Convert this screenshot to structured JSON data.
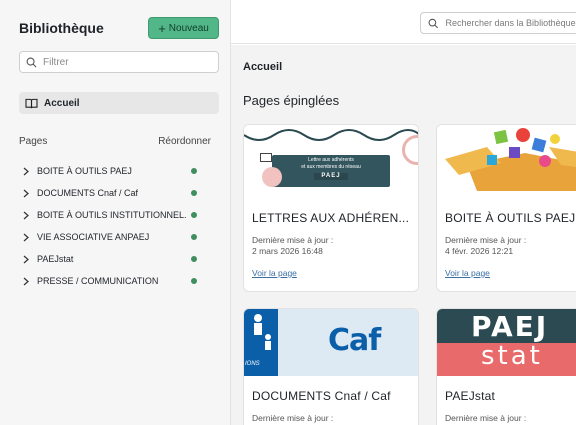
{
  "sidebar": {
    "title": "Bibliothèque",
    "new_button": {
      "icon": "plus-icon",
      "label": "Nouveau"
    },
    "filter": {
      "placeholder": "Filtrer"
    },
    "home": {
      "icon": "book-icon",
      "label": "Accueil"
    },
    "pages_label": "Pages",
    "reorder_label": "Réordonner",
    "pages": [
      {
        "label": "BOITE À OUTILS PAEJ"
      },
      {
        "label": "DOCUMENTS Cnaf / Caf"
      },
      {
        "label": "BOITE À OUTILS INSTITUTIONNEL..."
      },
      {
        "label": "VIE ASSOCIATIVE ANPAEJ"
      },
      {
        "label": "PAEJstat"
      },
      {
        "label": "PRESSE / COMMUNICATION"
      }
    ]
  },
  "topbar": {
    "search": {
      "placeholder": "Rechercher dans la Bibliothèque"
    }
  },
  "main": {
    "breadcrumb": "Accueil",
    "pinned_title": "Pages épinglées",
    "cards": [
      {
        "title": "LETTRES AUX ADHÉREN...",
        "updated_label": "Dernière mise à jour :",
        "date": "2 mars 2026 16:48",
        "link": "Voir la page",
        "thumb_text_1": "Lettre aux adhérents",
        "thumb_text_2": "et aux membres du réseau",
        "thumb_text_3": "PAEJ"
      },
      {
        "title": "BOITE À OUTILS PAEJ",
        "updated_label": "Dernière mise à jour :",
        "date": "4 févr. 2026 12:21",
        "link": "Voir la page"
      },
      {
        "title": "DOCUMENTS Cnaf / Caf",
        "updated_label": "Dernière mise à jour :",
        "thumb_word": "Caf",
        "thumb_small": "IONS"
      },
      {
        "title": "PAEJstat",
        "updated_label": "Dernière mise à jour :",
        "thumb_word_1": "PAEJ",
        "thumb_word_2": "stat"
      }
    ]
  },
  "colors": {
    "accent_green": "#52b788",
    "status_dot": "#3f8f5e",
    "link_blue": "#3a6ea5"
  }
}
